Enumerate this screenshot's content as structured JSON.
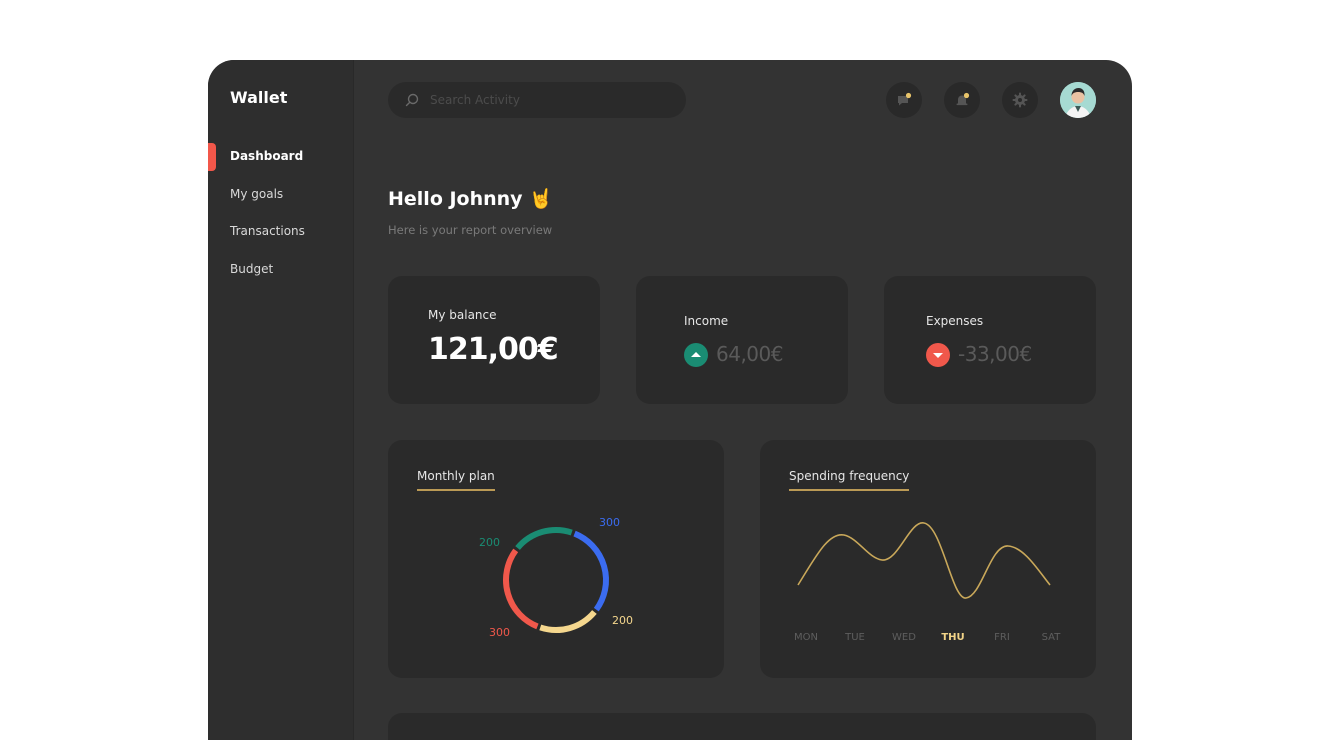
{
  "app": {
    "title": "Wallet"
  },
  "sidebar": {
    "items": [
      {
        "label": "Dashboard",
        "active": true
      },
      {
        "label": "My goals"
      },
      {
        "label": "Transactions"
      },
      {
        "label": "Budget"
      }
    ]
  },
  "header": {
    "search_placeholder": "Search Activity",
    "icons": [
      "chat-notification-icon",
      "bell-notification-icon",
      "gear-icon"
    ]
  },
  "greeting": {
    "title": "Hello Johnny 🤘",
    "subtitle": "Here is your report overview"
  },
  "cards": {
    "balance": {
      "label": "My balance",
      "value": "121,00€"
    },
    "income": {
      "label": "Income",
      "value": "64,00€"
    },
    "expenses": {
      "label": "Expenses",
      "value": "-33,00€"
    }
  },
  "monthly_plan": {
    "title": "Monthly plan",
    "labels": [
      "300",
      "200",
      "300",
      "200"
    ]
  },
  "spending_frequency": {
    "title": "Spending frequency",
    "days": [
      "MON",
      "TUE",
      "WED",
      "THU",
      "FRI",
      "SAT"
    ],
    "active_day": "THU"
  },
  "colors": {
    "accent": "#f2574a",
    "income": "#1a8c73",
    "expense": "#f0584b",
    "gold": "#c9a85a",
    "donut_blue": "#3b6cf0",
    "donut_yellow": "#f5d78e",
    "donut_red": "#f0584b",
    "donut_green": "#1a8c73"
  },
  "chart_data": [
    {
      "type": "pie",
      "title": "Monthly plan",
      "values": [
        300,
        200,
        300,
        200
      ],
      "colors": [
        "#3b6cf0",
        "#f5d78e",
        "#f0584b",
        "#1a8c73"
      ]
    },
    {
      "type": "line",
      "title": "Spending frequency",
      "categories": [
        "MON",
        "TUE",
        "WED",
        "THU",
        "FRI",
        "SAT"
      ]
    }
  ]
}
